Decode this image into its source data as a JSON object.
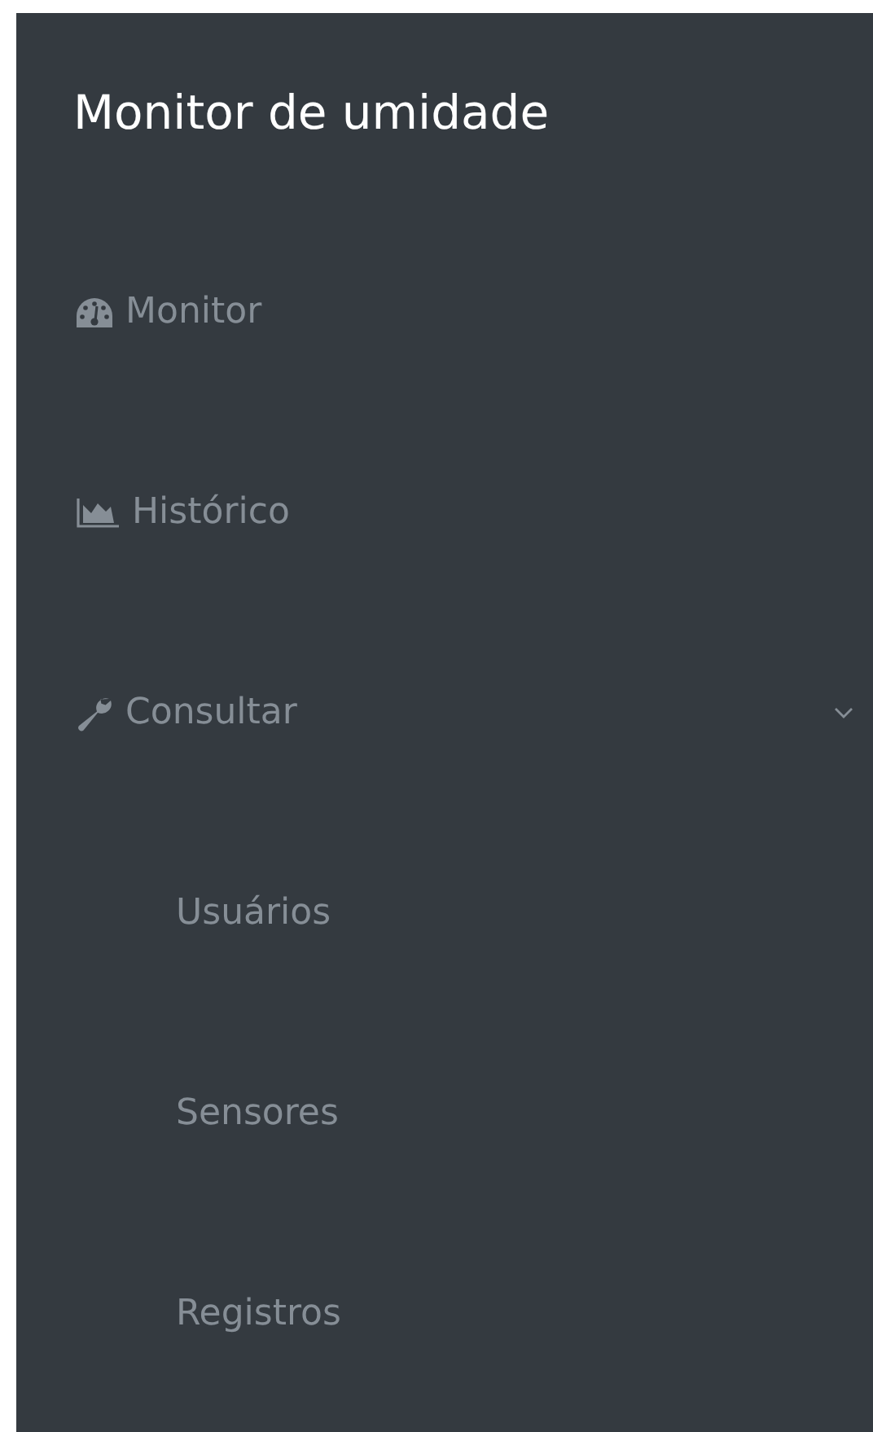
{
  "sidebar": {
    "title": "Monitor de umidade",
    "items": [
      {
        "label": "Monitor"
      },
      {
        "label": "Histórico"
      },
      {
        "label": "Consultar",
        "expanded": true,
        "children": [
          {
            "label": "Usuários"
          },
          {
            "label": "Sensores"
          },
          {
            "label": "Registros"
          }
        ]
      }
    ]
  }
}
